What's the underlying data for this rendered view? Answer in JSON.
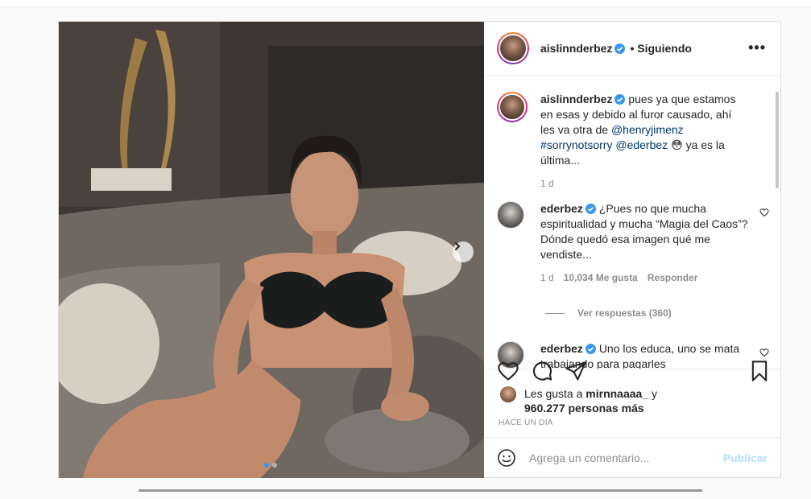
{
  "post": {
    "username": "aislinnderbez",
    "follow_status": "Siguiendo",
    "more_label": "•••",
    "caption": {
      "username": "aislinnderbez",
      "text_before": "pues ya que estamos en esas y debido al furor causado, ahí les va otra de",
      "mention1": "@henryjimenz",
      "hashtag": "#sorrynotsorry",
      "mention2": "@ederbez",
      "emoji": "😳",
      "text_after": "ya es la última...",
      "time": "1 d"
    },
    "comments": [
      {
        "username": "ederbez",
        "text": "¿Pues no que mucha espiritualidad y mucha “Magia del Caos”? Dónde quedó esa imagen qué me vendiste...",
        "time": "1 d",
        "likes": "10,034 Me gusta",
        "reply": "Responder",
        "view_replies": "Ver respuestas (360)"
      },
      {
        "username": "ederbez",
        "text": "Uno los educa, uno se mata trabajando para pagarles"
      }
    ],
    "likes": {
      "prefix": "Les gusta a",
      "user": "mirnnaaaa_",
      "conj": "y",
      "count": "960.277 personas más"
    },
    "time_ago": "HACE UN DÍA",
    "compose": {
      "placeholder": "Agrega un comentario...",
      "publish": "Publicar"
    },
    "carousel": {
      "current": 1,
      "total": 2
    },
    "colors": {
      "accent": "#3897f0",
      "verified": "#3897f0",
      "publish_disabled": "#b2dffc"
    }
  }
}
